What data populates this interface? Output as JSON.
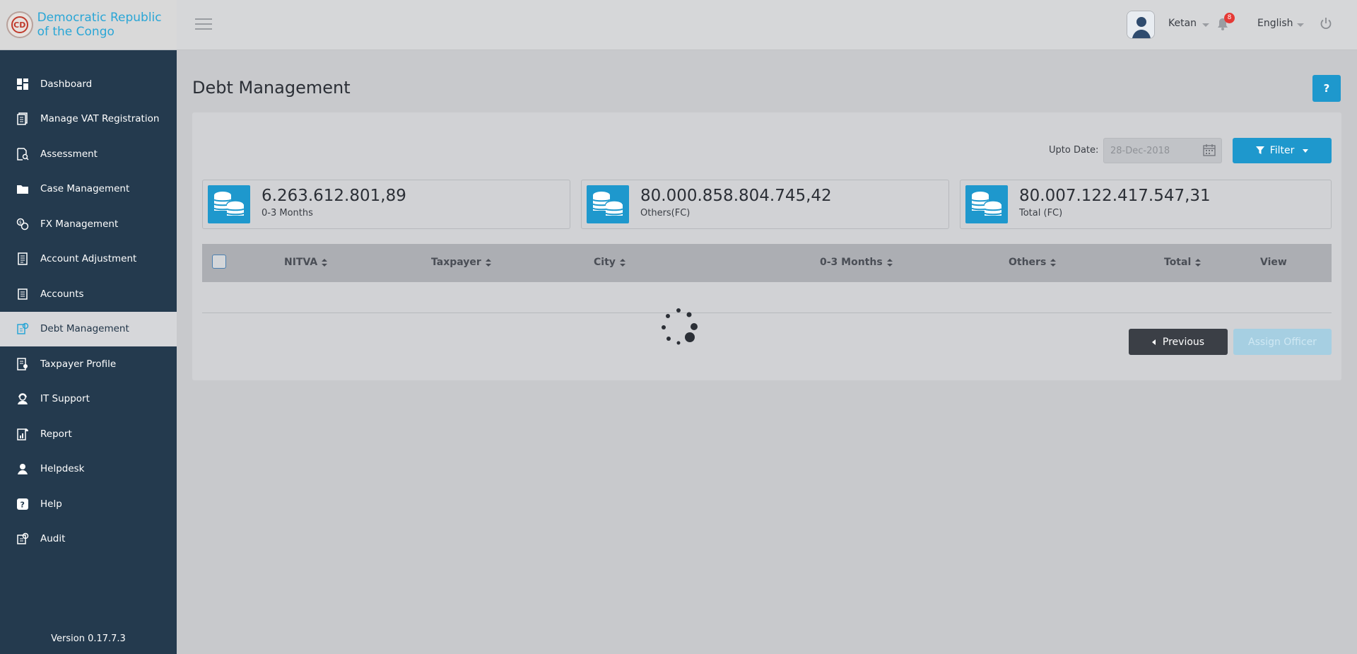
{
  "brand": {
    "name": "Democratic Republic of the Congo"
  },
  "sidebar": {
    "items": [
      {
        "label": "Dashboard",
        "icon": "dashboard-icon"
      },
      {
        "label": "Manage VAT Registration",
        "icon": "documents-icon"
      },
      {
        "label": "Assessment",
        "icon": "document-search-icon"
      },
      {
        "label": "Case Management",
        "icon": "folder-icon"
      },
      {
        "label": "FX Management",
        "icon": "exchange-icon"
      },
      {
        "label": "Account Adjustment",
        "icon": "ledger-icon"
      },
      {
        "label": "Accounts",
        "icon": "accounts-icon"
      },
      {
        "label": "Debt Management",
        "icon": "debt-icon"
      },
      {
        "label": "Taxpayer Profile",
        "icon": "profile-document-icon"
      },
      {
        "label": "IT Support",
        "icon": "support-agent-icon"
      },
      {
        "label": "Report",
        "icon": "report-icon"
      },
      {
        "label": "Helpdesk",
        "icon": "helpdesk-icon"
      },
      {
        "label": "Help",
        "icon": "question-icon"
      },
      {
        "label": "Audit",
        "icon": "audit-icon"
      }
    ],
    "active_index": 7,
    "version": "Version 0.17.7.3"
  },
  "topbar": {
    "user_name": "Ketan",
    "notification_count": "8",
    "language": "English"
  },
  "page": {
    "title": "Debt Management",
    "help_label": "?",
    "upto_date_label": "Upto Date:",
    "upto_date_value": "28-Dec-2018",
    "filter_label": "Filter"
  },
  "stats": [
    {
      "value": "6.263.612.801,89",
      "label": "0-3 Months"
    },
    {
      "value": "80.000.858.804.745,42",
      "label": "Others(FC)"
    },
    {
      "value": "80.007.122.417.547,31",
      "label": "Total (FC)"
    }
  ],
  "table": {
    "columns": [
      "NITVA",
      "Taxpayer",
      "City",
      "0-3 Months",
      "Others",
      "Total",
      "View"
    ]
  },
  "buttons": {
    "previous": "Previous",
    "assign_officer": "Assign Officer"
  },
  "colors": {
    "sidebar": "#243a4e",
    "accent": "#1e98cd",
    "brand_text": "#2aa6d6",
    "badge": "#e53935"
  }
}
